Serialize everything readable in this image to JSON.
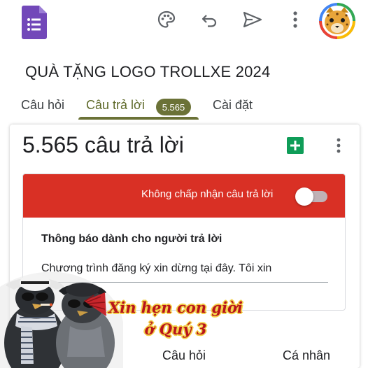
{
  "toolbar": {
    "icons": [
      "forms-logo-icon",
      "palette-icon",
      "undo-icon",
      "send-icon",
      "more-vert-icon",
      "avatar"
    ]
  },
  "form": {
    "title": "QUÀ TẶNG LOGO TROLLXE 2024"
  },
  "tabs": [
    {
      "label": "Câu hỏi",
      "active": false
    },
    {
      "label": "Câu trả lời",
      "active": true,
      "badge": "5.565"
    },
    {
      "label": "Cài đặt",
      "active": false
    }
  ],
  "responses": {
    "count_title": "5.565 câu trả lời",
    "accepting_label": "Không chấp nhận câu trả lời",
    "accepting": false,
    "message_heading": "Thông báo dành cho người trả lời",
    "message_text": "Chương trình đăng ký xin dừng tại đây. Tôi xin"
  },
  "sticker": {
    "caption_line1": "Xin hẹn con giời",
    "caption_line2": "ở Quý 3"
  },
  "bottom_nav": {
    "item1": "Câu hỏi",
    "item2": "Cá nhân"
  },
  "colors": {
    "accent": "#6b7237",
    "banner_red": "#d93025",
    "forms_purple": "#7248b9",
    "sheets_green": "#0f9d58"
  }
}
